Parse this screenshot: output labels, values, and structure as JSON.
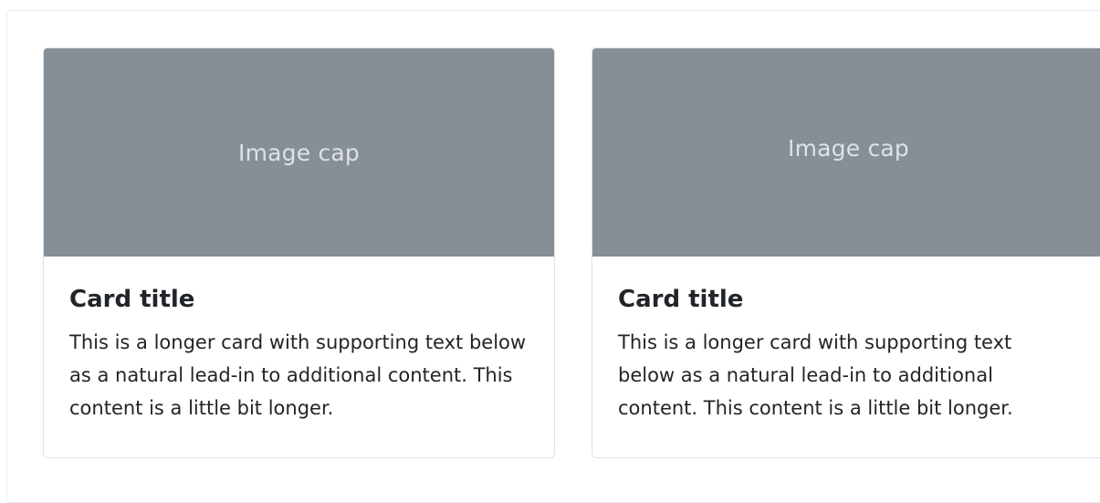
{
  "cards": [
    {
      "image_cap": "Image cap",
      "title": "Card title",
      "text": "This is a longer card with supporting text below as a natural lead-in to additional content. This content is a little bit longer."
    },
    {
      "image_cap": "Image cap",
      "title": "Card title",
      "text": "This is a longer card with supporting text below as a natural lead-in to additional content. This content is a little bit longer."
    }
  ],
  "colors": {
    "image_cap_background": "#868e96",
    "image_cap_text": "#dee2e6",
    "card_border": "#dee2e6",
    "body_text": "#212529"
  }
}
